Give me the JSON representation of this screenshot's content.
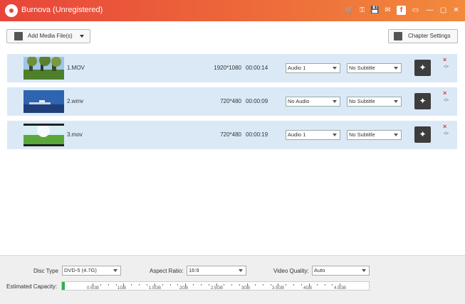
{
  "app": {
    "title": "Burnova (Unregistered)"
  },
  "toolbar": {
    "add_media_label": "Add Media File(s)",
    "chapter_settings_label": "Chapter Settings"
  },
  "media_rows": [
    {
      "file_name": "1.MOV",
      "resolution": "1920*1080",
      "duration": "00:00:14",
      "audio": "Audio 1",
      "subtitle": "No Subtitle"
    },
    {
      "file_name": "2.wmv",
      "resolution": "720*480",
      "duration": "00:00:09",
      "audio": "No Audio",
      "subtitle": "No Subtitle"
    },
    {
      "file_name": "3.mov",
      "resolution": "720*480",
      "duration": "00:00:19",
      "audio": "Audio 1",
      "subtitle": "No Subtitle"
    }
  ],
  "settings": {
    "disc_type_label": "Disc Type",
    "disc_type_value": "DVD-5 (4.7G)",
    "aspect_ratio_label": "Aspect Ratio:",
    "aspect_ratio_value": "16:9",
    "video_quality_label": "Video Quality:",
    "video_quality_value": "Auto"
  },
  "capacity": {
    "label": "Estimated Capacity:",
    "ticks": [
      "0.5GB",
      "1GB",
      "1.5GB",
      "2GB",
      "2.5GB",
      "3GB",
      "3.5GB",
      "4GB",
      "4.5GB"
    ],
    "used_fraction": 0.01
  },
  "icons": {
    "titlebar": [
      "cart-icon",
      "key-icon",
      "save-icon",
      "facebook-icon",
      "chat-icon",
      "minimize-icon",
      "restore-icon",
      "close-icon"
    ],
    "row_actions": [
      "edit-wand-icon",
      "remove-icon",
      "move-up-icon",
      "move-down-icon"
    ]
  },
  "colors": {
    "title_bar_start": "#e8453a",
    "title_bar_end": "#f28a3c",
    "row_bg": "#dbe9f7",
    "remove": "#e2332b",
    "capacity_fill": "#2fb14a"
  }
}
